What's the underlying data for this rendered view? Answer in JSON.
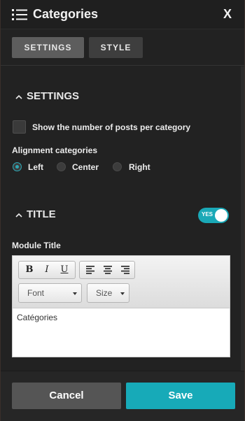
{
  "header": {
    "title": "Categories",
    "close_label": "X"
  },
  "tabs": [
    {
      "label": "SETTINGS",
      "active": true
    },
    {
      "label": "STYLE",
      "active": false
    }
  ],
  "settings_section": {
    "heading": "SETTINGS",
    "checkbox_label": "Show the number of posts per category",
    "checkbox_checked": false,
    "alignment_label": "Alignment categories",
    "alignment_options": [
      {
        "label": "Left",
        "checked": true
      },
      {
        "label": "Center",
        "checked": false
      },
      {
        "label": "Right",
        "checked": false
      }
    ]
  },
  "title_section": {
    "heading": "TITLE",
    "toggle_label": "YES",
    "toggle_on": true,
    "module_title_label": "Module Title",
    "editor": {
      "bold": "B",
      "italic": "I",
      "underline": "U",
      "font_select": "Font",
      "size_select": "Size",
      "content": "Catégories"
    }
  },
  "footer": {
    "cancel_label": "Cancel",
    "save_label": "Save"
  },
  "colors": {
    "accent": "#17aab8",
    "panel": "#222222",
    "header": "#1f1f1f"
  }
}
